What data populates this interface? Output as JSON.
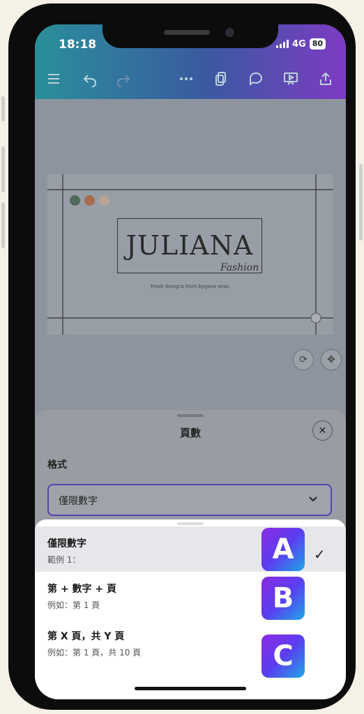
{
  "status": {
    "time": "18:18",
    "network": "4G",
    "battery": "80"
  },
  "toolbar": {
    "icons": [
      "menu-icon",
      "undo-icon",
      "redo-icon",
      "more-icon",
      "pages-icon",
      "comment-icon",
      "present-icon",
      "share-icon"
    ]
  },
  "design": {
    "brand": "JULIANA",
    "script": "Fashion",
    "tagline": "Fresh designs from bygone eras.",
    "swatches": [
      "#4e6a5a",
      "#a96c4e",
      "#b8a596"
    ]
  },
  "sheet": {
    "title": "頁數",
    "format_label": "格式",
    "selected_value": "僅限數字"
  },
  "menu": {
    "options": [
      {
        "title": "僅限數字",
        "example": "範例 1：",
        "badge": "A",
        "selected": true
      },
      {
        "title": "第 + 數字 + 頁",
        "example": "例如：第 1 頁",
        "badge": "B",
        "selected": false
      },
      {
        "title": "第 X 頁，共 Y 頁",
        "example": "例如：第 1 頁，共 10 頁",
        "badge": "C",
        "selected": false
      }
    ]
  },
  "colors": {
    "accent": "#5a3fb0",
    "gradient_start": "#2a8f9a",
    "gradient_end": "#7d3bc4"
  }
}
